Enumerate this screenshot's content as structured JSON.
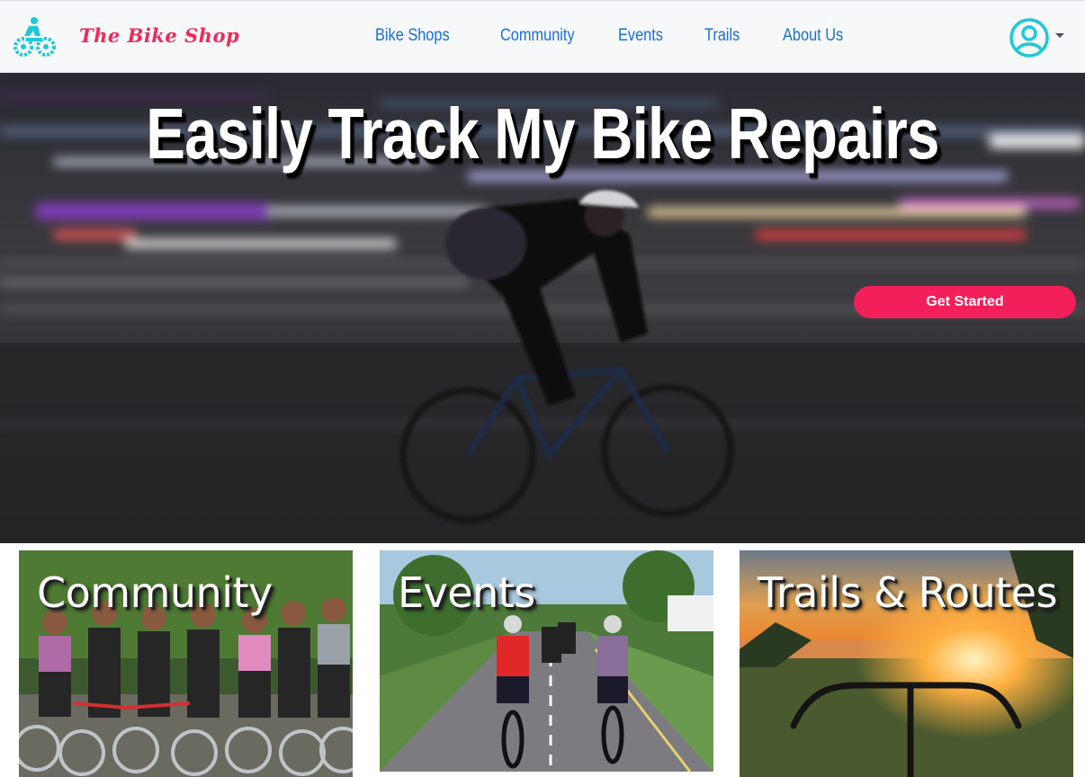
{
  "brand": {
    "name": "The Bike Shop",
    "logo_icon": "bike-gear-icon",
    "accent": "#f2295a",
    "logo_color": "#1ec8d8"
  },
  "nav": {
    "items": [
      {
        "label": "Bike Shops"
      },
      {
        "label": "Community"
      },
      {
        "label": "Events"
      },
      {
        "label": "Trails"
      },
      {
        "label": "About Us"
      }
    ],
    "link_color": "#1a6fd6",
    "account_icon": "user-circle-icon"
  },
  "hero": {
    "title": "Easily Track My Bike Repairs",
    "cta_label": "Get Started",
    "cta_color": "#f21f5a"
  },
  "cards": [
    {
      "title": "Community"
    },
    {
      "title": "Events"
    },
    {
      "title": "Trails & Routes"
    }
  ]
}
